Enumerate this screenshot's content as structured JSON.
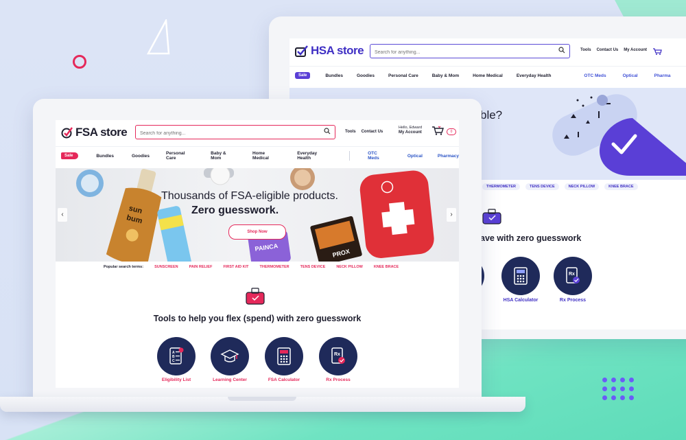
{
  "fsa": {
    "logo": "FSA store",
    "search_placeholder": "Search for anything...",
    "tools": "Tools",
    "contact": "Contact Us",
    "greeting": "Hello, Edward",
    "account": "My Account",
    "cart_count": "0",
    "nav": {
      "sale": "Sale",
      "items": [
        "Bundles",
        "Goodies",
        "Personal Care",
        "Baby & Mom",
        "Home Medical",
        "Everyday Health"
      ],
      "blue_items": [
        "OTC Meds",
        "Optical",
        "Pharmacy"
      ]
    },
    "hero": {
      "line1": "Thousands of FSA-eligible products.",
      "line2": "Zero guesswork.",
      "button": "Shop Now",
      "prev": "‹",
      "next": "›"
    },
    "popular": {
      "label": "Popular search terms:",
      "terms": [
        "SUNSCREEN",
        "PAIN RELIEF",
        "FIRST AID KIT",
        "THERMOMETER",
        "TENS DEVICE",
        "NECK PILLOW",
        "KNEE BRACE"
      ]
    },
    "tools_title": "Tools to help you flex (spend) with zero guesswork",
    "tools_list": [
      "Eligibility List",
      "Learning Center",
      "FSA Calculator",
      "Rx Process"
    ]
  },
  "hsa": {
    "logo": "HSA store",
    "search_placeholder": "Search for anything...",
    "tools": "Tools",
    "contact": "Contact Us",
    "account": "My Account",
    "nav": {
      "sale": "Sale",
      "items": [
        "Bundles",
        "Goodies",
        "Personal Care",
        "Baby & Mom",
        "Home Medical",
        "Everyday Health"
      ],
      "blue_items": [
        "OTC Meds",
        "Optical",
        "Pharma"
      ]
    },
    "hero_text": "ble?",
    "terms": [
      "IT",
      "THERMOMETER",
      "TENS DEVICE",
      "NECK PILLOW",
      "KNEE BRACE"
    ],
    "tools_title": "ave with zero guesswork",
    "tools_list": [
      "er",
      "HSA Calculator",
      "Rx Process"
    ]
  },
  "colors": {
    "fsa_accent": "#e5285a",
    "hsa_accent": "#3f2fc4",
    "navy": "#1f2a5a",
    "teal": "#6fe3c2",
    "background": "#dce4f6"
  }
}
